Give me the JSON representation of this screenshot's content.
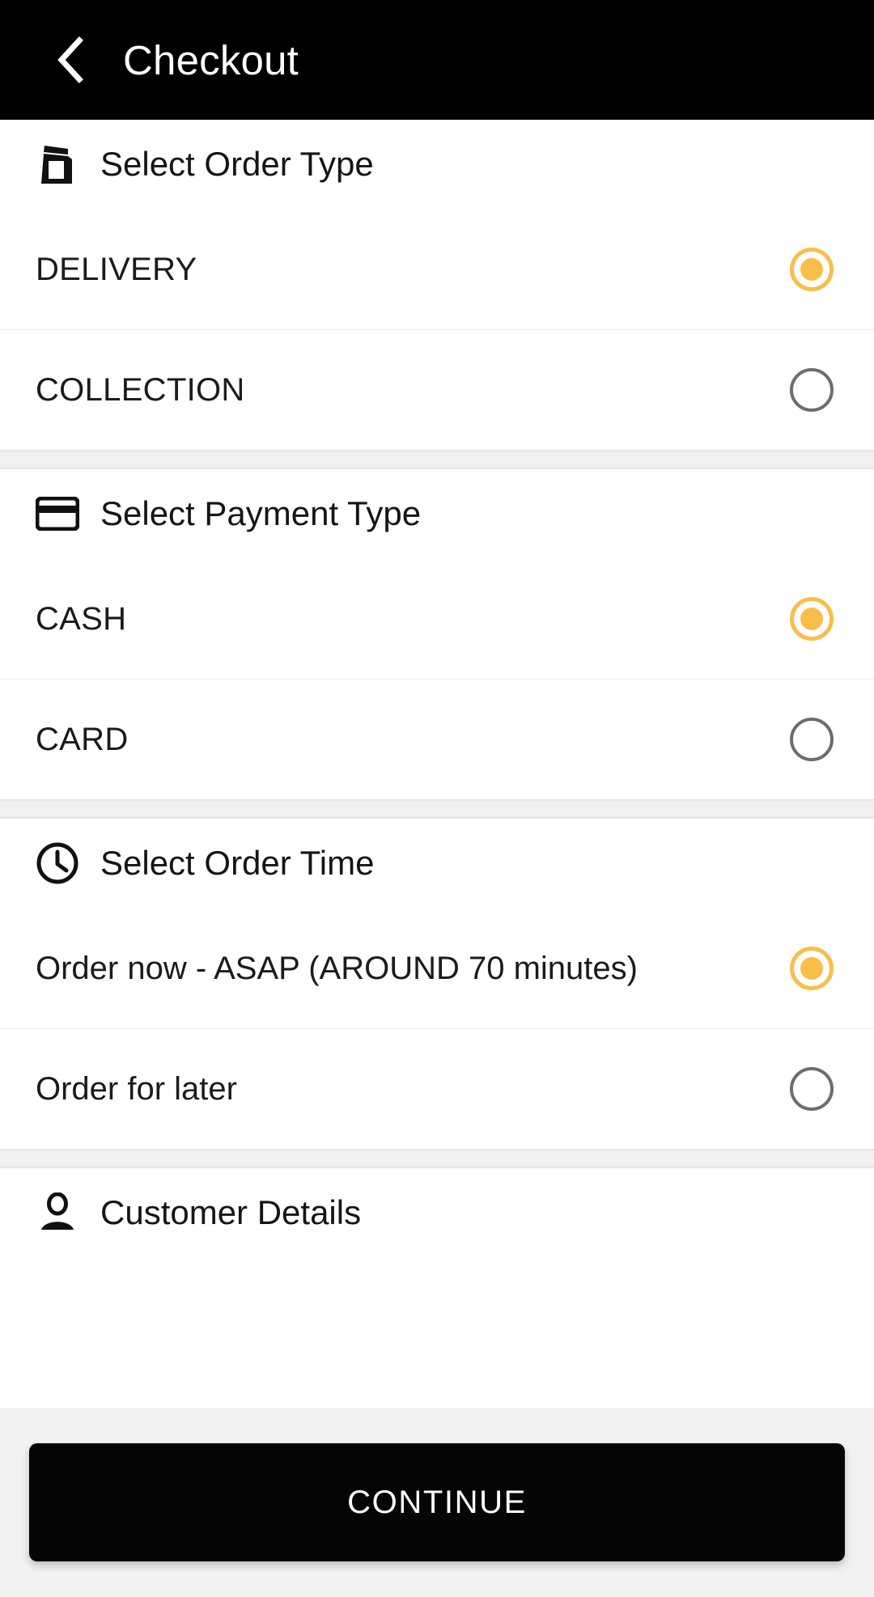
{
  "appbar": {
    "back_icon": "chevron-left-icon",
    "title": "Checkout"
  },
  "sections": [
    {
      "id": "order-type",
      "icon": "takeaway-bag-icon",
      "title": "Select Order Type",
      "options": [
        {
          "label": "DELIVERY",
          "selected": true
        },
        {
          "label": "COLLECTION",
          "selected": false
        }
      ]
    },
    {
      "id": "payment-type",
      "icon": "credit-card-icon",
      "title": "Select Payment Type",
      "options": [
        {
          "label": "CASH",
          "selected": true
        },
        {
          "label": "CARD",
          "selected": false
        }
      ]
    },
    {
      "id": "order-time",
      "icon": "clock-icon",
      "title": "Select Order Time",
      "options": [
        {
          "label": "Order now - ASAP (AROUND 70 minutes)",
          "selected": true
        },
        {
          "label": "Order for later",
          "selected": false
        }
      ]
    },
    {
      "id": "customer-details",
      "icon": "person-icon",
      "title": "Customer Details",
      "options": []
    }
  ],
  "footer": {
    "continue_label": "CONTINUE"
  },
  "colors": {
    "accent": "#f9be4a",
    "appbar_bg": "#000000",
    "radio_off": "#6d6d6d",
    "button_bg": "#050505",
    "page_bg": "#f2f2f2"
  }
}
